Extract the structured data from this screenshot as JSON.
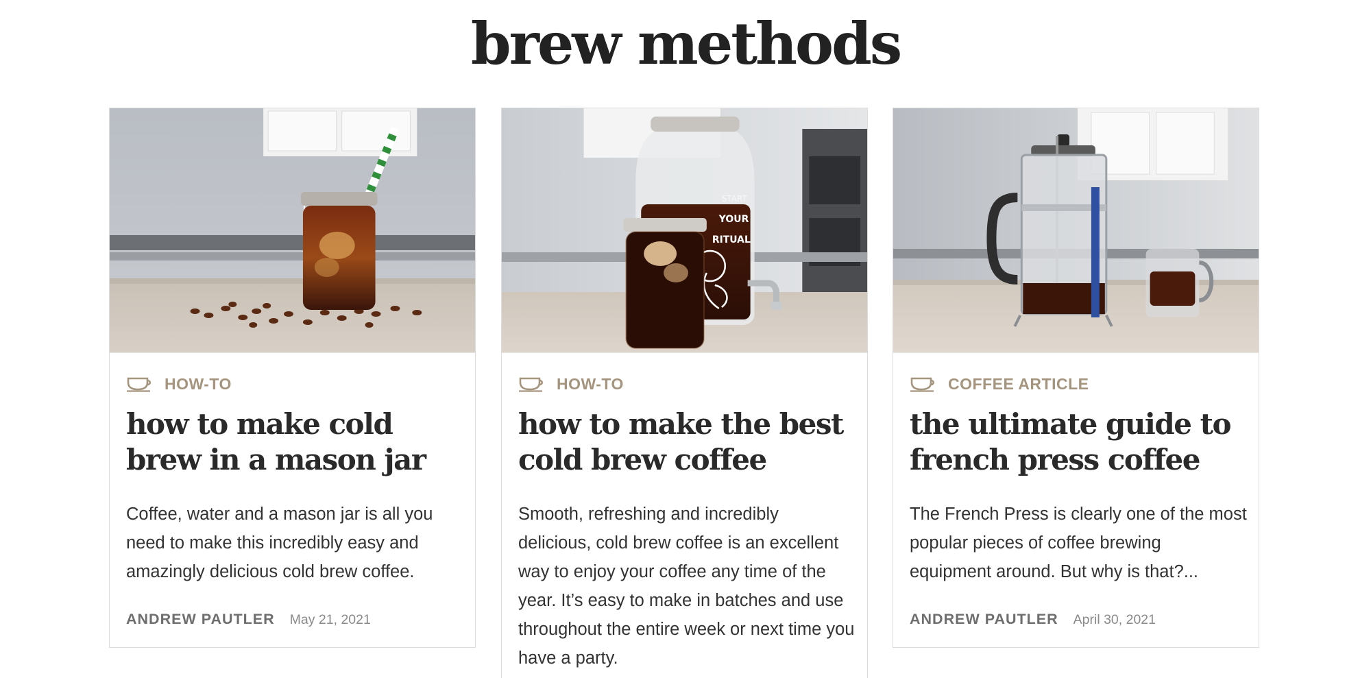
{
  "page": {
    "title": "brew methods"
  },
  "posts": [
    {
      "category": "HOW-TO",
      "title": "how to make cold brew in a mason jar",
      "excerpt": "Coffee, water and a mason jar is all you need to make this incredibly easy and amazingly delicious cold brew coffee.",
      "author": "ANDREW PAUTLER",
      "date": "May 21, 2021",
      "icon": "coffee-cup-icon"
    },
    {
      "category": "HOW-TO",
      "title": "how to make the best cold brew coffee",
      "excerpt": "Smooth, refreshing and incredibly delicious, cold brew coffee is an excellent way to enjoy your coffee any time of the year. It’s easy to make in batches and use throughout the entire week or next time you have a party.",
      "icon": "coffee-cup-icon"
    },
    {
      "category": "COFFEE ARTICLE",
      "title": "the ultimate guide to french press coffee",
      "excerpt": "The French Press is clearly one of the most popular pieces of coffee brewing equipment around. But why is that?...",
      "author": "ANDREW PAUTLER",
      "date": "April 30, 2021",
      "icon": "coffee-cup-icon"
    }
  ],
  "colors": {
    "category": "#a6957e",
    "heading": "#222222",
    "body_text": "#333333",
    "author": "#6e6e6e",
    "date": "#8a8a8a",
    "card_border": "#dcdcdc"
  }
}
